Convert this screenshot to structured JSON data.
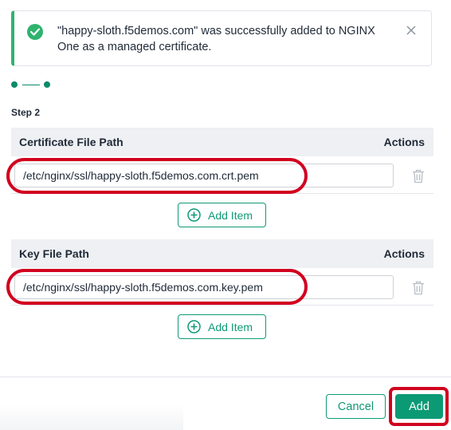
{
  "toast": {
    "message": "\"happy-sloth.f5demos.com\" was successfully added to NGINX One as a managed certificate.",
    "status_icon": "check-circle-icon",
    "close_icon": "close-icon",
    "success_color": "#2fb36f"
  },
  "step_label": "Step 2",
  "certificate_section": {
    "header": "Certificate File Path",
    "actions_header": "Actions",
    "path_value": "/etc/nginx/ssl/happy-sloth.f5demos.com.crt.pem",
    "add_item_label": "Add Item"
  },
  "key_section": {
    "header": "Key File Path",
    "actions_header": "Actions",
    "path_value": "/etc/nginx/ssl/happy-sloth.f5demos.com.key.pem",
    "add_item_label": "Add Item"
  },
  "footer": {
    "cancel_label": "Cancel",
    "add_label": "Add"
  },
  "colors": {
    "accent": "#0c9a75",
    "annotation": "#d1001f"
  }
}
